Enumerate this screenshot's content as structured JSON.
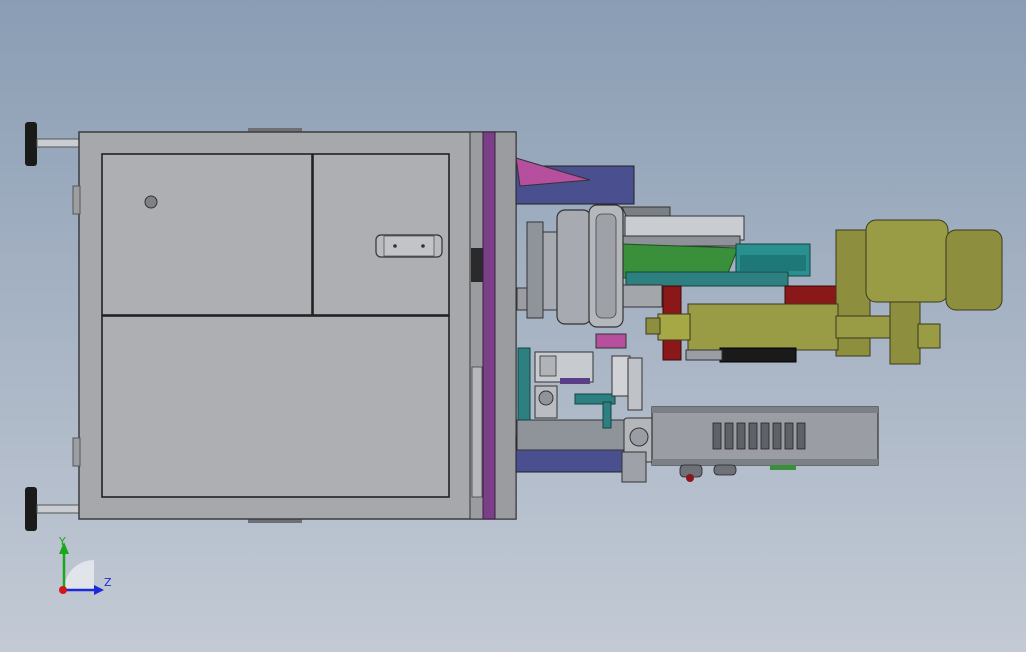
{
  "triad": {
    "y_label": "Y",
    "z_label": "Z",
    "y_color": "#1aa81a",
    "z_color": "#1a2bd6",
    "origin_color": "#d01818"
  },
  "colors": {
    "housing": "#a9abaf",
    "housing_dark": "#4a4c50",
    "panel_line": "#2a2a2c",
    "divider_plate": "#7a3f86",
    "navy_tube": "#4a4f8f",
    "pink_guard": "#b54f9e",
    "green_block": "#3a8f3a",
    "teal_block": "#2a8f8f",
    "olive_motor": "#8e8f3e",
    "dark_red_bracket": "#8a1818",
    "grey_metal": "#8f939a",
    "light_metal": "#cfd2d6",
    "black": "#1a1a1a"
  }
}
